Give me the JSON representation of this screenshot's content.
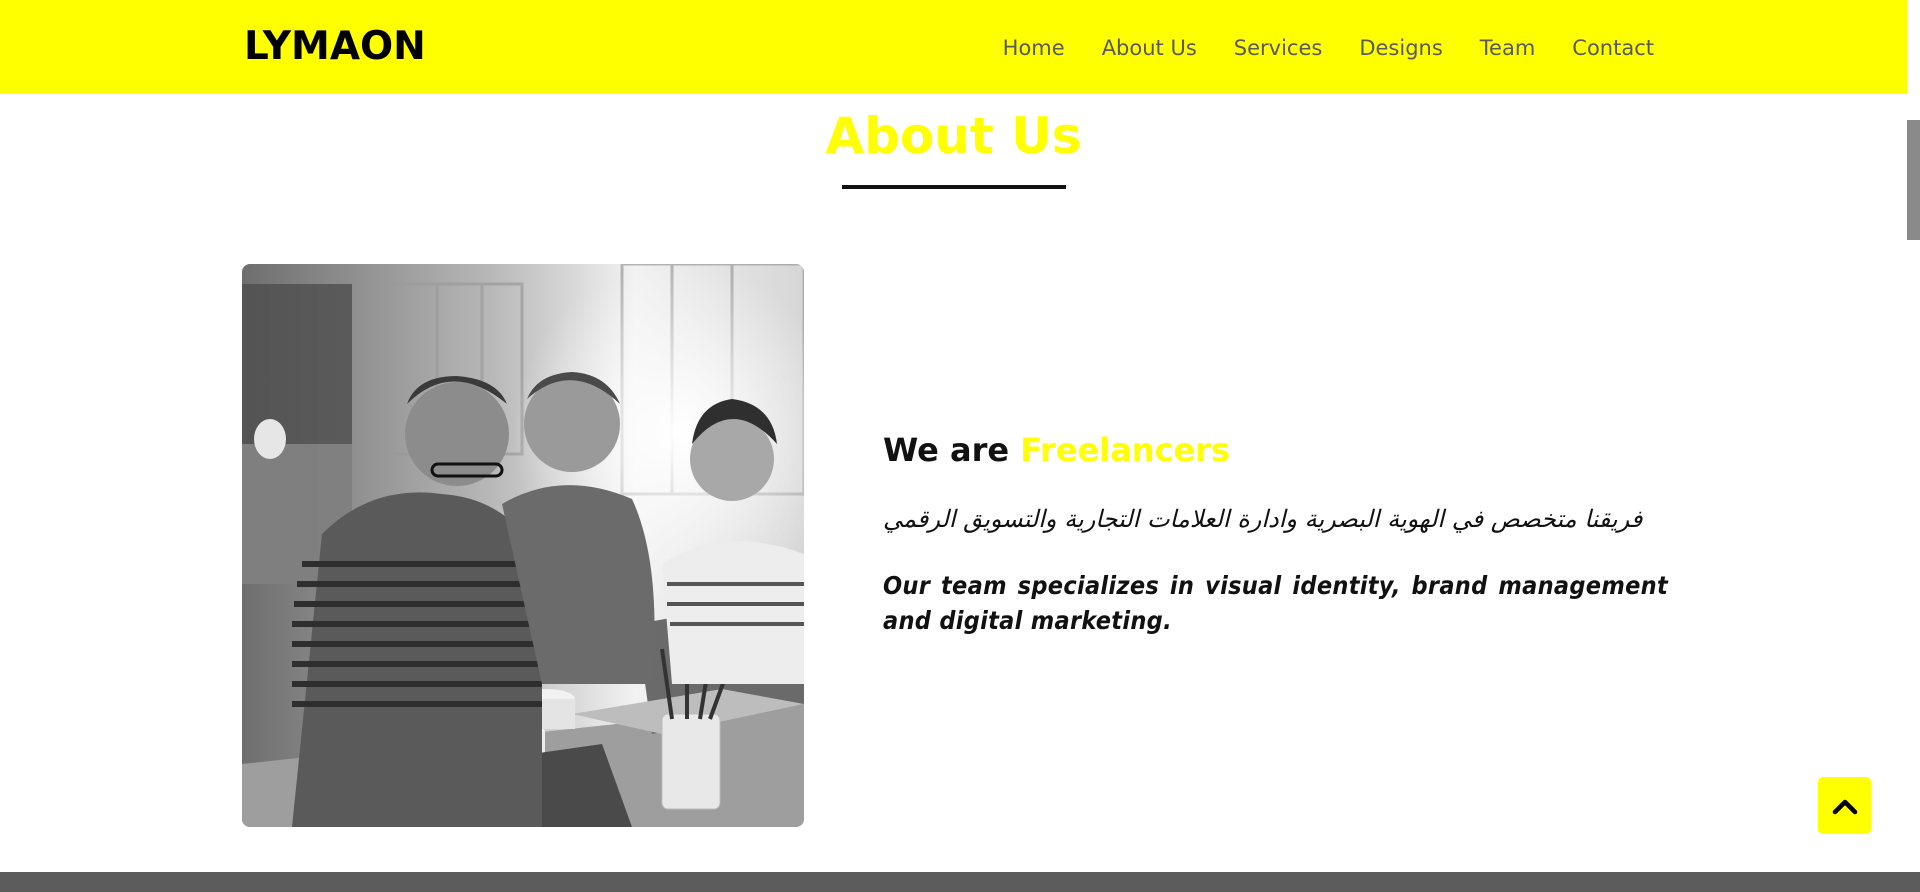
{
  "header": {
    "logo_text": "LYMAON",
    "nav": [
      {
        "label": "Home"
      },
      {
        "label": "About Us"
      },
      {
        "label": "Services"
      },
      {
        "label": "Designs"
      },
      {
        "label": "Team"
      },
      {
        "label": "Contact"
      }
    ]
  },
  "about": {
    "title": "About Us",
    "headline_prefix": "We are ",
    "headline_accent": "Freelancers",
    "arabic_text": "فريقنا متخصص في الهوية البصرية وادارة العلامات التجارية والتسويق الرقمي",
    "english_text": "Our team specializes in visual identity, brand management and digital marketing.",
    "photo_icon": "team-photo"
  },
  "back_to_top": {
    "icon": "chevron-up-icon"
  },
  "colors": {
    "brand_yellow": "#ffff00",
    "nav_text": "#5a5a5a",
    "text_dark": "#111111",
    "footer_gray": "#5c5c5c"
  }
}
